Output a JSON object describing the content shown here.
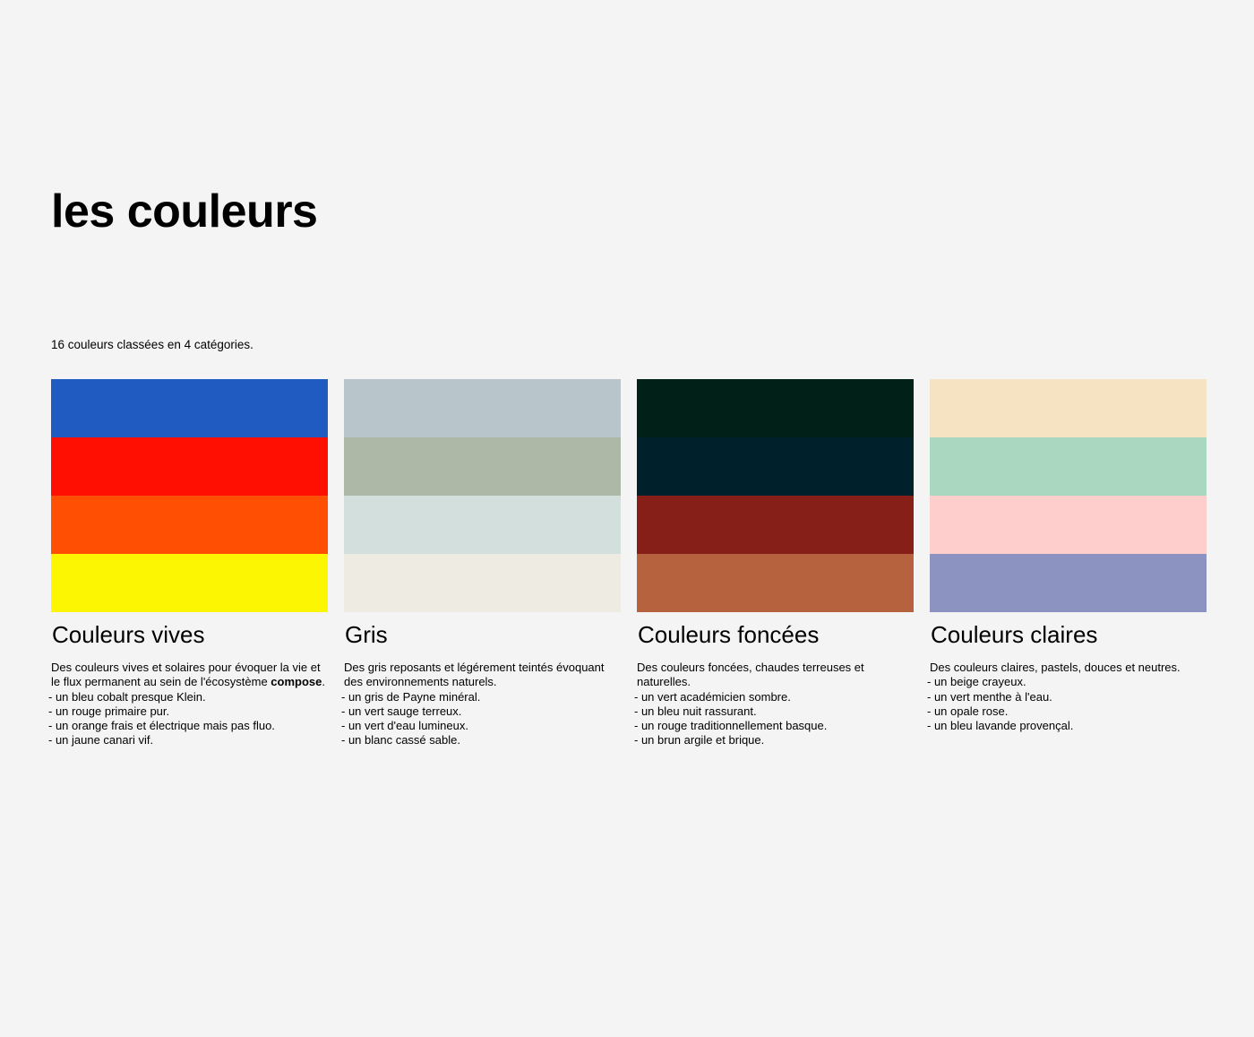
{
  "page": {
    "title": "les couleurs",
    "intro": "16 couleurs classées en 4 catégories."
  },
  "categories": [
    {
      "title": "Couleurs vives",
      "colors": [
        "#1f5bc1",
        "#ff0f02",
        "#ff4f03",
        "#fcf602"
      ],
      "intro_text": "Des couleurs vives et solaires pour évoquer la vie et le flux permanent au sein de l'écosystème ",
      "intro_bold": "compose",
      "intro_end": ".",
      "items": [
        "- un bleu cobalt presque Klein.",
        "- un rouge primaire pur.",
        "- un orange frais et électrique mais pas fluo.",
        "- un jaune canari vif."
      ]
    },
    {
      "title": "Gris",
      "colors": [
        "#b8c5cb",
        "#adb9a6",
        "#d3dfdc",
        "#eeebe3"
      ],
      "intro_text": "Des gris reposants et légérement teintés évoquant des environnements naturels.",
      "intro_bold": "",
      "intro_end": "",
      "items": [
        "- un gris de Payne minéral.",
        "- un vert sauge terreux.",
        "- un vert d'eau lumineux.",
        "- un blanc cassé sable."
      ]
    },
    {
      "title": "Couleurs foncées",
      "colors": [
        "#002018",
        "#00212c",
        "#851f18",
        "#b7623e"
      ],
      "intro_text": "Des couleurs foncées, chaudes terreuses et naturelles.",
      "intro_bold": "",
      "intro_end": "",
      "items": [
        "- un vert académicien sombre.",
        "- un bleu nuit rassurant.",
        "- un rouge traditionnellement basque.",
        "- un brun argile et brique."
      ]
    },
    {
      "title": "Couleurs claires",
      "colors": [
        "#f5e3c2",
        "#a9d7c0",
        "#fececc",
        "#8d93c0"
      ],
      "intro_text": "Des couleurs claires, pastels, douces et neutres.",
      "intro_bold": "",
      "intro_end": "",
      "items": [
        "- un beige crayeux.",
        "- un vert menthe à l'eau.",
        "- un opale rose.",
        "- un bleu lavande provençal."
      ]
    }
  ]
}
